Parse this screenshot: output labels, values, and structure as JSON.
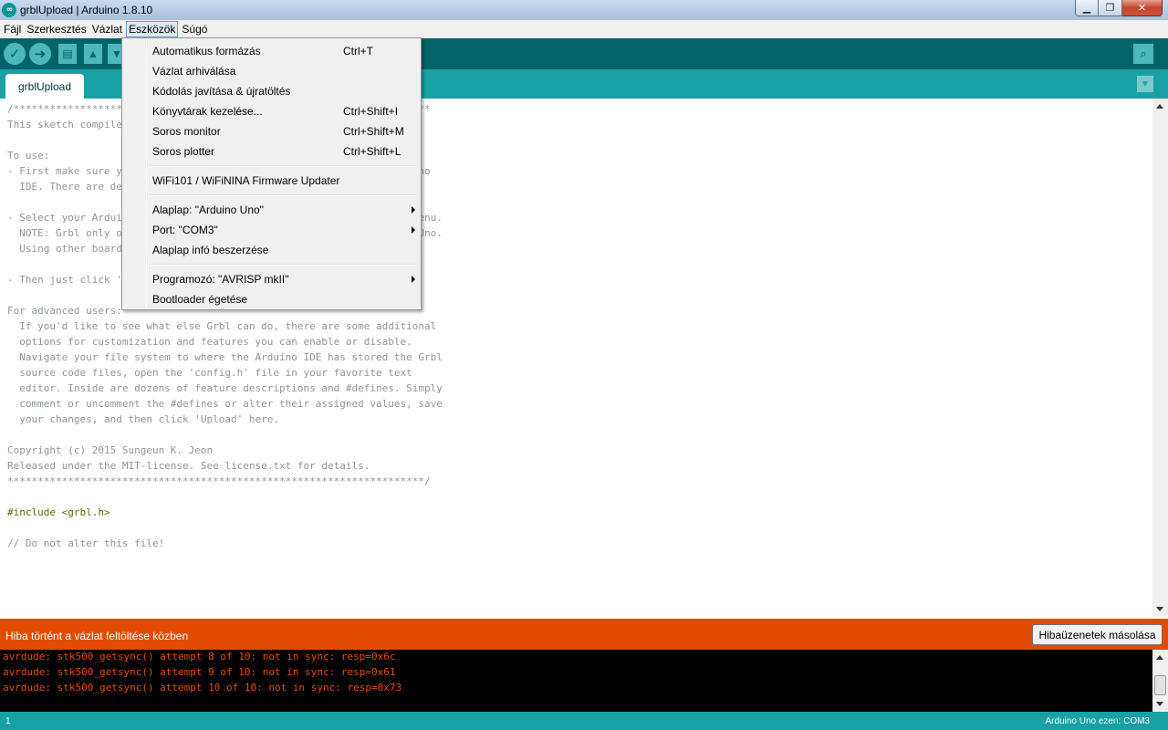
{
  "window": {
    "title": "grblUpload | Arduino 1.8.10",
    "controls": [
      "▁",
      "❐",
      "✕"
    ]
  },
  "menubar": [
    "Fájl",
    "Szerkesztés",
    "Vázlat",
    "Eszközök",
    "Súgó"
  ],
  "active_menu_index": 3,
  "tools_menu": {
    "groups": [
      [
        {
          "label": "Automatikus formázás",
          "shortcut": "Ctrl+T"
        },
        {
          "label": "Vázlat arhiválása",
          "shortcut": ""
        },
        {
          "label": "Kódolás javítása & újratöltés",
          "shortcut": ""
        },
        {
          "label": "Könyvtárak kezelése...",
          "shortcut": "Ctrl+Shift+I"
        },
        {
          "label": "Soros monitor",
          "shortcut": "Ctrl+Shift+M"
        },
        {
          "label": "Soros plotter",
          "shortcut": "Ctrl+Shift+L"
        }
      ],
      [
        {
          "label": "WiFi101 / WiFiNINA Firmware Updater",
          "shortcut": ""
        }
      ],
      [
        {
          "label": "Alaplap: \"Arduino Uno\"",
          "shortcut": "",
          "submenu": true
        },
        {
          "label": "Port: \"COM3\"",
          "shortcut": "",
          "submenu": true
        },
        {
          "label": "Alaplap infó beszerzése",
          "shortcut": ""
        }
      ],
      [
        {
          "label": "Programozó: \"AVRISP mkII\"",
          "shortcut": "",
          "submenu": true
        },
        {
          "label": "Bootloader égetése",
          "shortcut": ""
        }
      ]
    ]
  },
  "toolbar": {
    "buttons": [
      "verify-icon",
      "upload-icon",
      "new-icon",
      "open-icon",
      "save-icon"
    ],
    "serial_monitor": "serial-monitor-icon"
  },
  "tab": {
    "label": "grblUpload"
  },
  "editor": {
    "lines": [
      "/*********************************************************************",
      "This sketch compiles and uploads Grbl to your 328p-based Arduino!",
      "",
      "To use:",
      "- First make sure you have imported Grbl source code into your Arduino",
      "  IDE. There are details on our Github website on how to do this.",
      "",
      "- Select your Arduino Board and Serial Port in the Tools drop-down menu.",
      "  NOTE: Grbl only officially supports 328p-based Arduinos, like the Uno.",
      "  Using other boards will likely not work!",
      "",
      "- Then just click 'Upload'. That's it!",
      "",
      "For advanced users:",
      "  If you'd like to see what else Grbl can do, there are some additional",
      "  options for customization and features you can enable or disable.",
      "  Navigate your file system to where the Arduino IDE has stored the Grbl",
      "  source code files, open the 'config.h' file in your favorite text",
      "  editor. Inside are dozens of feature descriptions and #defines. Simply",
      "  comment or uncomment the #defines or alter their assigned values, save",
      "  your changes, and then click 'Upload' here.",
      "",
      "Copyright (c) 2015 Sungeun K. Jeon",
      "Released under the MIT-license. See license.txt for details.",
      "*********************************************************************/",
      "",
      "#include <grbl.h>",
      "",
      "// Do not alter this file!"
    ]
  },
  "error": {
    "message": "Hiba történt a vázlat feltöltése közben",
    "copy_button": "Hibaüzenetek másolása"
  },
  "console": {
    "lines": [
      "avrdude: stk500_getsync() attempt 8 of 10: not in sync: resp=0x6c",
      "avrdude: stk500_getsync() attempt 9 of 10: not in sync: resp=0x61",
      "avrdude: stk500_getsync() attempt 10 of 10: not in sync: resp=0x73"
    ]
  },
  "status": {
    "line": "1",
    "board": "Arduino Uno ezen: COM3"
  }
}
